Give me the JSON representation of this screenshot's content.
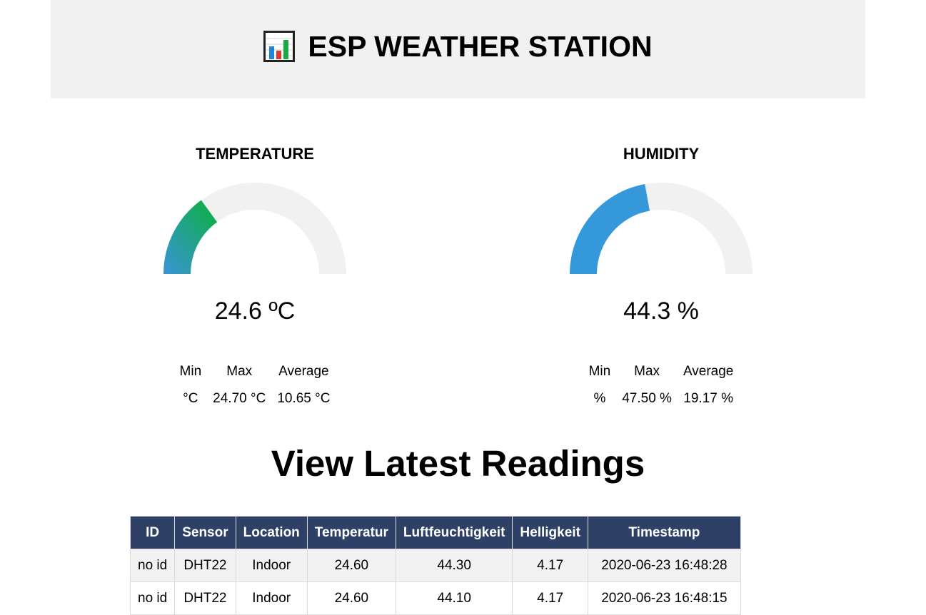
{
  "header": {
    "icon": "bar-chart-icon",
    "title": "ESP WEATHER STATION"
  },
  "temperature": {
    "title": "TEMPERATURE",
    "value_text": "24.6 ºC",
    "gauge_fraction": 0.3,
    "stats": {
      "headers": [
        "Min",
        "Max",
        "Average"
      ],
      "values": [
        "°C",
        "24.70 °C",
        "10.65 °C"
      ]
    },
    "colors": {
      "gradient_start": "#3a94d8",
      "gradient_end": "#0bb03d",
      "track": "#f1f1f1"
    }
  },
  "humidity": {
    "title": "HUMIDITY",
    "value_text": "44.3 %",
    "gauge_fraction": 0.443,
    "stats": {
      "headers": [
        "Min",
        "Max",
        "Average"
      ],
      "values": [
        "%",
        "47.50 %",
        "19.17 %"
      ]
    },
    "colors": {
      "fill": "#3498db",
      "track": "#f1f1f1"
    }
  },
  "readings": {
    "title": "View Latest Readings",
    "columns": [
      "ID",
      "Sensor",
      "Location",
      "Temperatur",
      "Luftfeuchtigkeit",
      "Helligkeit",
      "Timestamp"
    ],
    "rows": [
      [
        "no id",
        "DHT22",
        "Indoor",
        "24.60",
        "44.30",
        "4.17",
        "2020-06-23 16:48:28"
      ],
      [
        "no id",
        "DHT22",
        "Indoor",
        "24.60",
        "44.10",
        "4.17",
        "2020-06-23 16:48:15"
      ]
    ],
    "header_color": "#2e4066"
  }
}
